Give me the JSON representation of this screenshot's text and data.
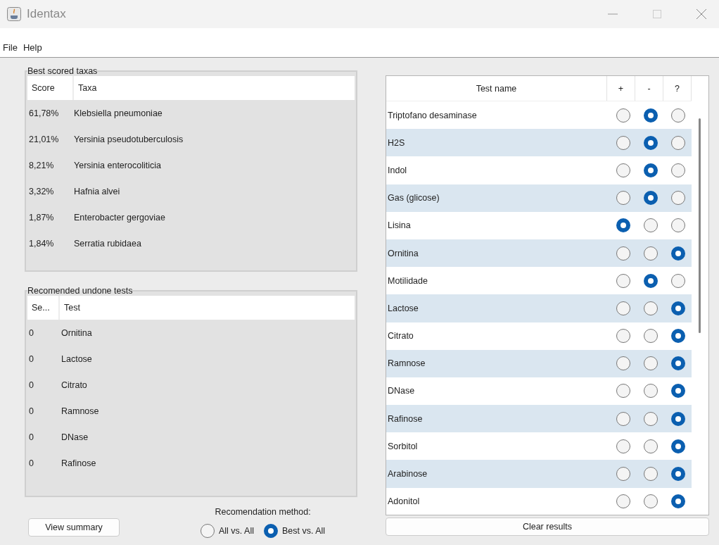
{
  "window": {
    "title": "Identax"
  },
  "menu": [
    "File",
    "Help"
  ],
  "best_scored": {
    "title": "Best scored taxas",
    "columns": [
      "Score",
      "Taxa"
    ],
    "rows": [
      {
        "score": "61,78%",
        "taxa": "Klebsiella pneumoniae"
      },
      {
        "score": "21,01%",
        "taxa": "Yersinia pseudotuberculosis"
      },
      {
        "score": "8,21%",
        "taxa": "Yersinia enterocoliticia"
      },
      {
        "score": "3,32%",
        "taxa": "Hafnia alvei"
      },
      {
        "score": "1,87%",
        "taxa": "Enterobacter gergoviae"
      },
      {
        "score": "1,84%",
        "taxa": "Serratia rubidaea"
      }
    ]
  },
  "recommended": {
    "title": "Recomended undone tests",
    "columns": [
      "Se...",
      "Test"
    ],
    "rows": [
      {
        "score": "0",
        "test": "Ornitina"
      },
      {
        "score": "0",
        "test": "Lactose"
      },
      {
        "score": "0",
        "test": "Citrato"
      },
      {
        "score": "0",
        "test": "Ramnose"
      },
      {
        "score": "0",
        "test": "DNase"
      },
      {
        "score": "0",
        "test": "Rafinose"
      }
    ]
  },
  "view_summary_button": "View summary",
  "recommendation_method": {
    "label": "Recomendation method:",
    "options": [
      {
        "label": "All vs. All",
        "selected": false
      },
      {
        "label": "Best vs. All",
        "selected": true
      }
    ]
  },
  "tests": {
    "columns": [
      "Test name",
      "+",
      "-",
      "?"
    ],
    "rows": [
      {
        "name": "Triptofano desaminase",
        "options": [
          {
            "selected": false
          },
          {
            "selected": true
          },
          {
            "selected": false
          }
        ]
      },
      {
        "name": "H2S",
        "options": [
          {
            "selected": false
          },
          {
            "selected": true
          },
          {
            "selected": false
          }
        ]
      },
      {
        "name": "Indol",
        "options": [
          {
            "selected": false
          },
          {
            "selected": true
          },
          {
            "selected": false
          }
        ]
      },
      {
        "name": "Gas (glicose)",
        "options": [
          {
            "selected": false
          },
          {
            "selected": true
          },
          {
            "selected": false
          }
        ]
      },
      {
        "name": "Lisina",
        "options": [
          {
            "selected": true
          },
          {
            "selected": false
          },
          {
            "selected": false
          }
        ]
      },
      {
        "name": "Ornitina",
        "options": [
          {
            "selected": false
          },
          {
            "selected": false
          },
          {
            "selected": true
          }
        ]
      },
      {
        "name": "Motilidade",
        "options": [
          {
            "selected": false
          },
          {
            "selected": true
          },
          {
            "selected": false
          }
        ]
      },
      {
        "name": "Lactose",
        "options": [
          {
            "selected": false
          },
          {
            "selected": false
          },
          {
            "selected": true
          }
        ]
      },
      {
        "name": "Citrato",
        "options": [
          {
            "selected": false
          },
          {
            "selected": false
          },
          {
            "selected": true
          }
        ]
      },
      {
        "name": "Ramnose",
        "options": [
          {
            "selected": false
          },
          {
            "selected": false
          },
          {
            "selected": true
          }
        ]
      },
      {
        "name": "DNase",
        "options": [
          {
            "selected": false
          },
          {
            "selected": false
          },
          {
            "selected": true
          }
        ]
      },
      {
        "name": "Rafinose",
        "options": [
          {
            "selected": false
          },
          {
            "selected": false
          },
          {
            "selected": true
          }
        ]
      },
      {
        "name": "Sorbitol",
        "options": [
          {
            "selected": false
          },
          {
            "selected": false
          },
          {
            "selected": true
          }
        ]
      },
      {
        "name": "Arabinose",
        "options": [
          {
            "selected": false
          },
          {
            "selected": false
          },
          {
            "selected": true
          }
        ]
      },
      {
        "name": "Adonitol",
        "options": [
          {
            "selected": false
          },
          {
            "selected": false
          },
          {
            "selected": true
          }
        ]
      }
    ]
  },
  "clear_results_button": "Clear results"
}
